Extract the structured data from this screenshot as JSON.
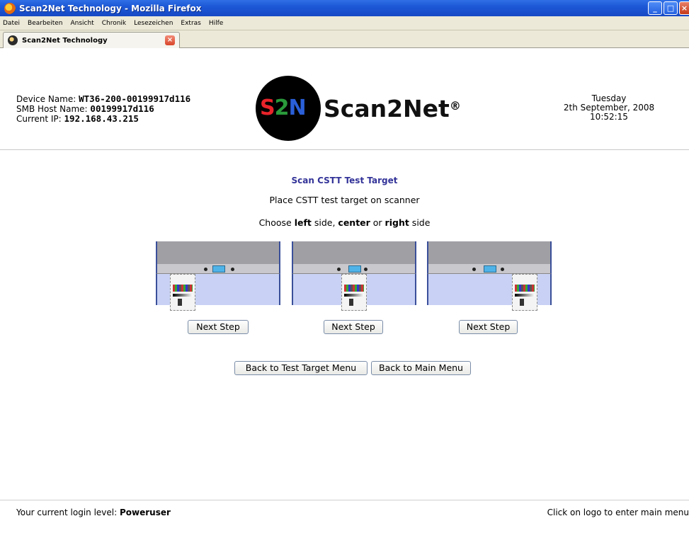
{
  "window": {
    "title": "Scan2Net Technology - Mozilla Firefox"
  },
  "menubar": {
    "items": [
      "Datei",
      "Bearbeiten",
      "Ansicht",
      "Chronik",
      "Lesezeichen",
      "Extras",
      "Hilfe"
    ]
  },
  "tab": {
    "label": "Scan2Net Technology"
  },
  "device": {
    "name_label": "Device Name: ",
    "name_value": "WT36-200-00199917d116",
    "smb_label": "SMB Host Name: ",
    "smb_value": "00199917d116",
    "ip_label": "Current IP: ",
    "ip_value": "192.168.43.215"
  },
  "logo": {
    "badge_s": "S",
    "badge_2": "2",
    "badge_n": "N",
    "wordmark": "Scan2Net",
    "reg": "®",
    "badge_colors": {
      "s": "#e8232a",
      "two": "#2a9a3a",
      "n": "#2a5fd8"
    }
  },
  "datetime": {
    "day": "Tuesday",
    "date": "2th September, 2008",
    "time": "10:52:15"
  },
  "main": {
    "title": "Scan CSTT Test Target",
    "instruction1": "Place CSTT test target on scanner",
    "choose_prefix": "Choose ",
    "choose_left": "left",
    "choose_mid1": " side, ",
    "choose_center": "center",
    "choose_mid2": " or ",
    "choose_right": "right",
    "choose_suffix": " side",
    "options": [
      {
        "position": "left",
        "button": "Next Step"
      },
      {
        "position": "center",
        "button": "Next Step"
      },
      {
        "position": "right",
        "button": "Next Step"
      }
    ],
    "back_test_target": "Back to Test Target Menu",
    "back_main": "Back to Main Menu"
  },
  "footer": {
    "login_label": "Your current login level: ",
    "login_value": "Poweruser",
    "hint": "Click on logo to enter main menu"
  }
}
